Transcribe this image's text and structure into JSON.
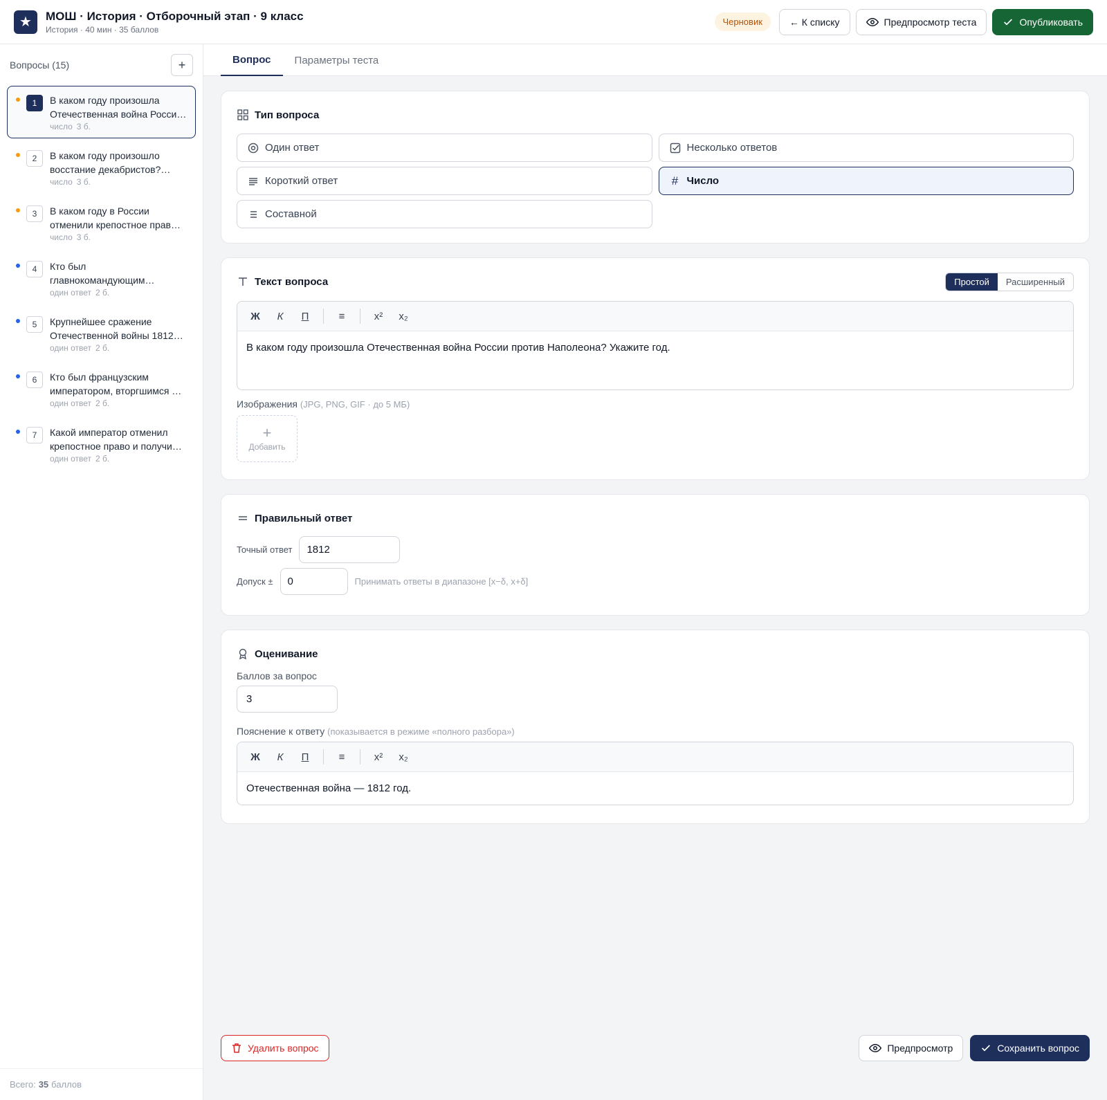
{
  "header": {
    "title": "МОШ · История · Отборочный этап · 9 класс",
    "subtitle": "История · 40 мин · 35 баллов",
    "status_badge": "Черновик",
    "back_label": "← К списку",
    "preview_test_label": "Предпросмотр теста",
    "publish_label": "Опубликовать"
  },
  "sidebar": {
    "title": "Вопросы (15)",
    "add_label": "+",
    "items": [
      {
        "num": "1",
        "text": "В каком году произошла Отечественная война Росси…",
        "type": "число",
        "points": "3 б.",
        "dot": "#f59e0b"
      },
      {
        "num": "2",
        "text": "В каком году произошло восстание декабристов?…",
        "type": "число",
        "points": "3 б.",
        "dot": "#f59e0b"
      },
      {
        "num": "3",
        "text": "В каком году в России отменили крепостное прав…",
        "type": "число",
        "points": "3 б.",
        "dot": "#f59e0b"
      },
      {
        "num": "4",
        "text": "Кто был главнокомандующим…",
        "type": "один ответ",
        "points": "2 б.",
        "dot": "#2563eb"
      },
      {
        "num": "5",
        "text": "Крупнейшее сражение Отечественной войны 1812…",
        "type": "один ответ",
        "points": "2 б.",
        "dot": "#2563eb"
      },
      {
        "num": "6",
        "text": "Кто был французским императором, вторгшимся …",
        "type": "один ответ",
        "points": "2 б.",
        "dot": "#2563eb"
      },
      {
        "num": "7",
        "text": "Какой император отменил крепостное право и получи…",
        "type": "один ответ",
        "points": "2 б.",
        "dot": "#2563eb"
      }
    ],
    "footer_prefix": "Всего:",
    "footer_value": "35",
    "footer_suffix": "баллов"
  },
  "tabs": [
    {
      "label": "Вопрос"
    },
    {
      "label": "Параметры теста"
    }
  ],
  "question_type": {
    "title": "Тип вопроса",
    "options": [
      {
        "label": "Один ответ",
        "icon": "radio-icon"
      },
      {
        "label": "Несколько ответов",
        "icon": "checkbox-icon"
      },
      {
        "label": "Короткий ответ",
        "icon": "text-lines-icon"
      },
      {
        "label": "Число",
        "icon": "hash-icon",
        "selected": true
      },
      {
        "label": "Составной",
        "icon": "list-icon"
      }
    ]
  },
  "question_text": {
    "title": "Текст вопроса",
    "mode_simple": "Простой",
    "mode_extended": "Расширенный",
    "toolbar": {
      "bold": "Ж",
      "italic": "К",
      "underline": "П",
      "list": "≡",
      "sup": "x²",
      "sub": "x₂"
    },
    "content": "В каком году произошла Отечественная война России против Наполеона? Укажите год.",
    "images_label": "Изображения",
    "images_hint": "(JPG, PNG, GIF · до 5 МБ)",
    "add_image_label": "Добавить"
  },
  "correct_answer": {
    "title": "Правильный ответ",
    "exact_label": "Точный ответ",
    "exact_value": "1812",
    "tolerance_label": "Допуск ±",
    "tolerance_value": "0",
    "tolerance_hint": "Принимать ответы в диапазоне [x−δ, x+δ]"
  },
  "grading": {
    "title": "Оценивание",
    "points_label": "Баллов за вопрос",
    "points_value": "3",
    "explanation_label": "Пояснение к ответу",
    "explanation_hint": "(показывается в режиме «полного разбора»)",
    "explanation_text": "Отечественная война — 1812 год."
  },
  "footer_actions": {
    "delete_label": "Удалить вопрос",
    "preview_label": "Предпросмотр",
    "save_label": "Сохранить вопрос"
  },
  "colors": {
    "navy": "#1e2f5c",
    "publish_green": "#166534",
    "danger": "#dc2626",
    "draft_badge": "#b45309"
  }
}
